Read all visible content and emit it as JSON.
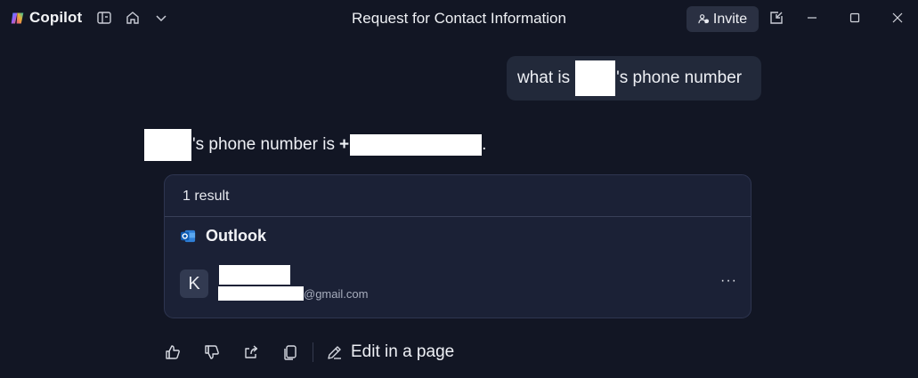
{
  "app": {
    "name": "Copilot"
  },
  "window": {
    "title": "Request for Contact Information"
  },
  "toolbar": {
    "invite_label": "Invite"
  },
  "user_message": {
    "prefix": "what is",
    "suffix": "'s phone number"
  },
  "answer": {
    "middle": "'s phone number is",
    "plus": "+",
    "end": "."
  },
  "result_card": {
    "count_label": "1 result",
    "source": "Outlook",
    "contact": {
      "initial": "K",
      "email_domain": "@gmail.com"
    },
    "more": "···"
  },
  "actions": {
    "edit_label": "Edit in a page"
  },
  "colors": {
    "background": "#121624",
    "card": "#1b2136",
    "bubble": "#22293a"
  }
}
